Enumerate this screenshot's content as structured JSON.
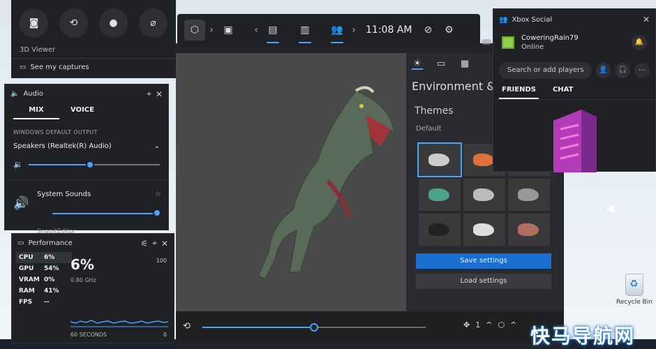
{
  "capture": {
    "buttons": [
      "camera-icon",
      "record-last-icon",
      "record-icon",
      "mic-off-icon"
    ],
    "app_name": "3D Viewer",
    "see_captures": "See my captures"
  },
  "gamebar": {
    "time": "11:08 AM"
  },
  "audio": {
    "title": "Audio",
    "tab_mix": "MIX",
    "tab_voice": "VOICE",
    "section": "WINDOWS DEFAULT OUTPUT",
    "device": "Speakers (Realtek(R) Audio)",
    "master_volume": 0.47,
    "app_name": "System Sounds",
    "app_volume": 1.0,
    "cut_text": "SnagitEditor"
  },
  "performance": {
    "title": "Performance",
    "items": [
      {
        "label": "CPU",
        "value": "6%"
      },
      {
        "label": "GPU",
        "value": "54%"
      },
      {
        "label": "VRAM",
        "value": "0%"
      },
      {
        "label": "RAM",
        "value": "41%"
      },
      {
        "label": "FPS",
        "value": "--"
      }
    ],
    "big_value": "6%",
    "ghz": "0.80 GHz",
    "max": "100",
    "min": "0",
    "seconds": "60 SECONDS"
  },
  "environment": {
    "title": "Environment &",
    "themes": "Themes",
    "default": "Default",
    "save": "Save settings",
    "load": "Load settings"
  },
  "playbar": {
    "count": "1",
    "progress": 0.5
  },
  "social": {
    "title": "Xbox Social",
    "user": "CoweringRain79",
    "status": "Online",
    "search_placeholder": "Search or add players",
    "tab_friends": "FRIENDS",
    "tab_chat": "CHAT"
  },
  "desktop": {
    "recycle_label": "Recycle Bin"
  },
  "watermark": "快马导航网"
}
